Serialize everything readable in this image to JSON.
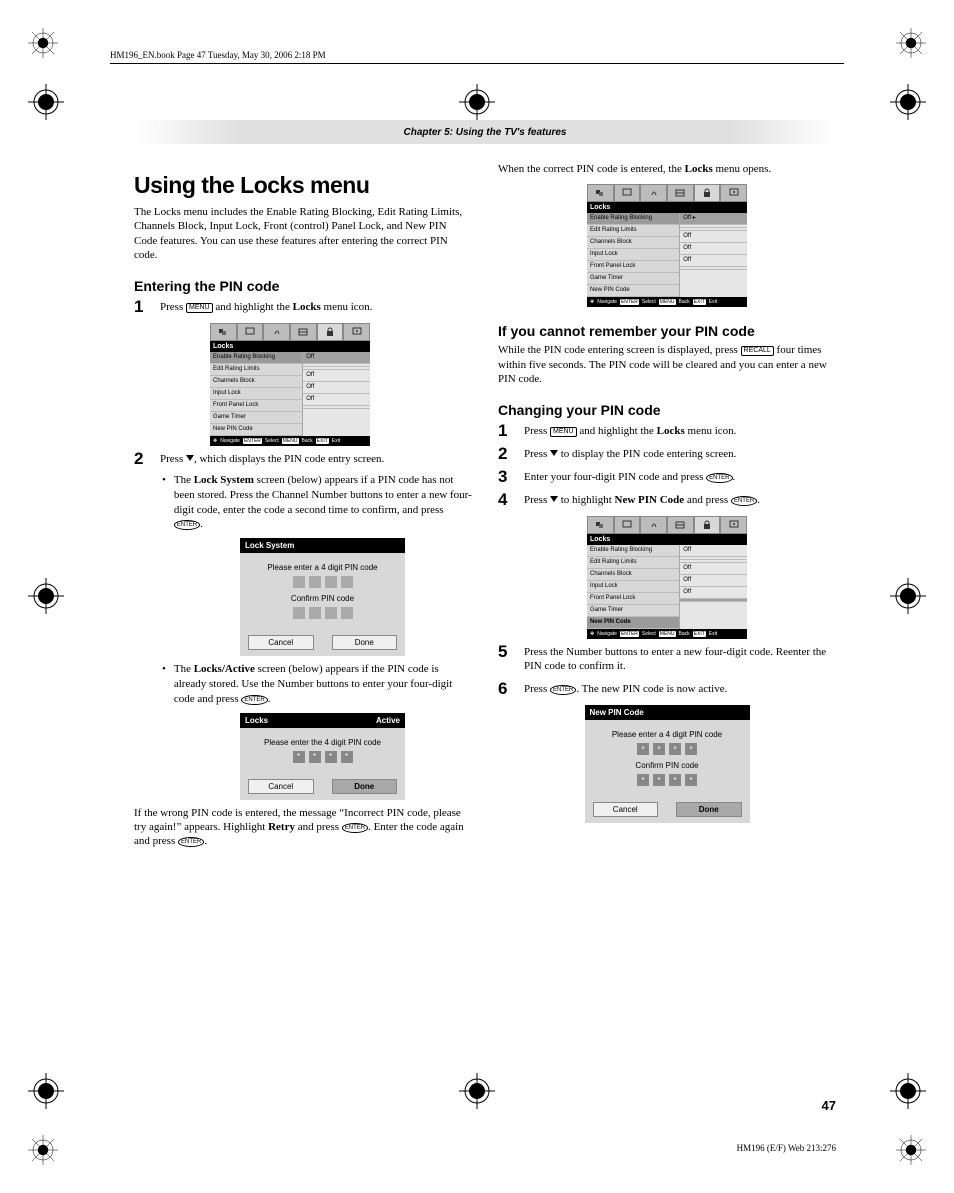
{
  "runhead": "HM196_EN.book  Page 47  Tuesday, May 30, 2006  2:18 PM",
  "chapter": "Chapter 5: Using the TV's features",
  "left": {
    "h1": "Using the Locks menu",
    "intro": "The Locks menu includes the Enable Rating Blocking, Edit Rating Limits, Channels Block, Input Lock, Front (control) Panel Lock, and New PIN Code features. You can use these features after entering the correct PIN code.",
    "h2": "Entering the PIN code",
    "s1_pre": "Press ",
    "s1_key": "MENU",
    "s1_post": " and highlight the ",
    "s1_bold": "Locks",
    "s1_post2": " menu icon.",
    "s2_pre": "Press ",
    "s2_post": ", which displays the PIN code entry screen.",
    "b1_pre": "The ",
    "b1_bold": "Lock System",
    "b1_post": " screen (below) appears if a PIN code has not been stored. Press the Channel Number buttons to enter a new four-digit code, enter the code a second time to confirm, and press ",
    "b1_key": "ENTER",
    "b1_end": ".",
    "b2_pre": "The ",
    "b2_bold": "Locks/Active",
    "b2_post": " screen (below) appears if the PIN code is already stored. Use the Number buttons to enter your four-digit code and press ",
    "b2_key": "ENTER",
    "b2_end": ".",
    "wrong_pre": "If the wrong PIN code is entered, the message “Incorrect PIN code, please try again!” appears. Highlight ",
    "wrong_b": "Retry",
    "wrong_mid": " and press ",
    "wrong_k1": "ENTER",
    "wrong_mid2": ". Enter the code again and press ",
    "wrong_k2": "ENTER",
    "wrong_end": "."
  },
  "right": {
    "intro_pre": "When the correct PIN code is entered, the ",
    "intro_b": "Locks",
    "intro_post": " menu opens.",
    "h2a": "If you cannot remember your PIN code",
    "forgot_pre": "While the PIN code entering screen is displayed, press ",
    "forgot_key": "RECALL",
    "forgot_post": " four times within five seconds. The PIN code will be cleared and you can enter a new PIN code.",
    "h2b": "Changing your PIN code",
    "c1_pre": "Press ",
    "c1_key": "MENU",
    "c1_mid": " and highlight the ",
    "c1_b": "Locks",
    "c1_post": " menu icon.",
    "c2_pre": "Press ",
    "c2_post": " to display the PIN code entering screen.",
    "c3_pre": "Enter your four-digit PIN code and press ",
    "c3_key": "ENTER",
    "c3_end": ".",
    "c4_pre": "Press ",
    "c4_mid": " to highlight ",
    "c4_b": "New PIN Code",
    "c4_mid2": " and press ",
    "c4_key": "ENTER",
    "c4_end": ".",
    "c5": "Press the Number buttons to enter a new four-digit code. Reenter the PIN code to confirm it.",
    "c6_pre": "Press ",
    "c6_key": "ENTER",
    "c6_post": ". The new PIN code is now active."
  },
  "osd": {
    "title": "Locks",
    "rows": [
      "Enable Rating Blocking",
      "Edit Rating Limits",
      "Channels Block",
      "Input Lock",
      "Front Panel Lock",
      "Game Timer",
      "New PIN Code"
    ],
    "vals": [
      "Off",
      "",
      "",
      "Off",
      "Off",
      "Off",
      ""
    ],
    "sel_top": "Off ▸",
    "nav": "Navigate",
    "sel": "Select",
    "back": "Back",
    "exit": "Exit",
    "k_enter": "ENTER",
    "k_menu": "MENU",
    "k_exit": "EXIT"
  },
  "dlg1": {
    "title": "Lock System",
    "l1": "Please enter a 4 digit PIN code",
    "l2": "Confirm PIN code",
    "cancel": "Cancel",
    "done": "Done"
  },
  "dlg2": {
    "title": "Locks",
    "status": "Active",
    "l1": "Please enter the 4 digit PIN code",
    "cancel": "Cancel",
    "done": "Done"
  },
  "dlg3": {
    "title": "New PIN Code",
    "l1": "Please enter a 4 digit PIN code",
    "l2": "Confirm PIN code",
    "cancel": "Cancel",
    "done": "Done"
  },
  "pgnum": "47",
  "imprint": "HM196 (E/F) Web 213:276"
}
